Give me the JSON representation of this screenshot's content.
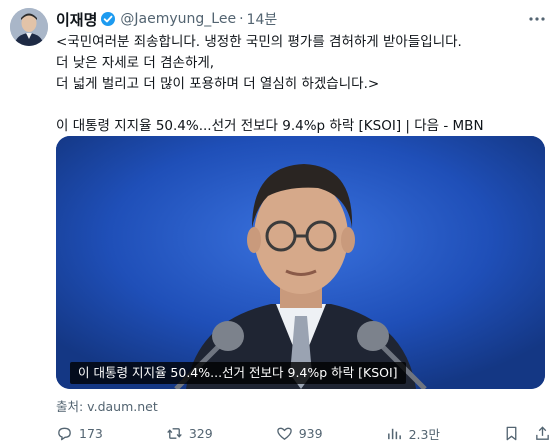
{
  "author": {
    "name": "이재명",
    "handle": "@Jaemyung_Lee",
    "separator": "·",
    "time": "14분"
  },
  "post": {
    "text": "<국민여러분 죄송합니다. 냉정한 국민의 평가를 겸허하게 받아들입니다.\n더 낮은 자세로 더 겸손하게,\n더 넓게 벌리고 더 많이 포용하며 더 열심히 하겠습니다.>\n\n이 대통령 지지율 50.4%...선거 전보다 9.4%p 하락 [KSOI] | 다음 - MBN"
  },
  "media": {
    "caption": "이 대통령 지지율 50.4%...선거 전보다 9.4%p 하락 [KSOI]",
    "source": "출처: v.daum.net"
  },
  "actions": {
    "replies": "173",
    "reposts": "329",
    "likes": "939",
    "views": "2.3만"
  },
  "colors": {
    "verified": "#1d9bf0",
    "muted": "#536471",
    "media_bg": "#1f4fb8"
  }
}
